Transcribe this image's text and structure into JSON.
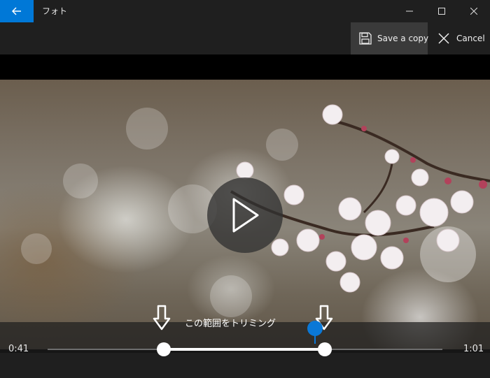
{
  "titlebar": {
    "app_title": "フォト",
    "icons": {
      "back": "back-arrow-icon",
      "minimize": "minimize-icon",
      "maximize": "maximize-icon",
      "close": "close-icon"
    }
  },
  "command_bar": {
    "save_copy_label": "Save a copy",
    "cancel_label": "Cancel",
    "icons": {
      "save": "floppy-disk-icon",
      "cancel": "x-icon"
    }
  },
  "video": {
    "play_icon": "play-icon"
  },
  "trim": {
    "hint": "この範囲をトリミング",
    "start_time": "0:41",
    "end_time": "1:01",
    "colors": {
      "accent": "#0078d7"
    }
  }
}
